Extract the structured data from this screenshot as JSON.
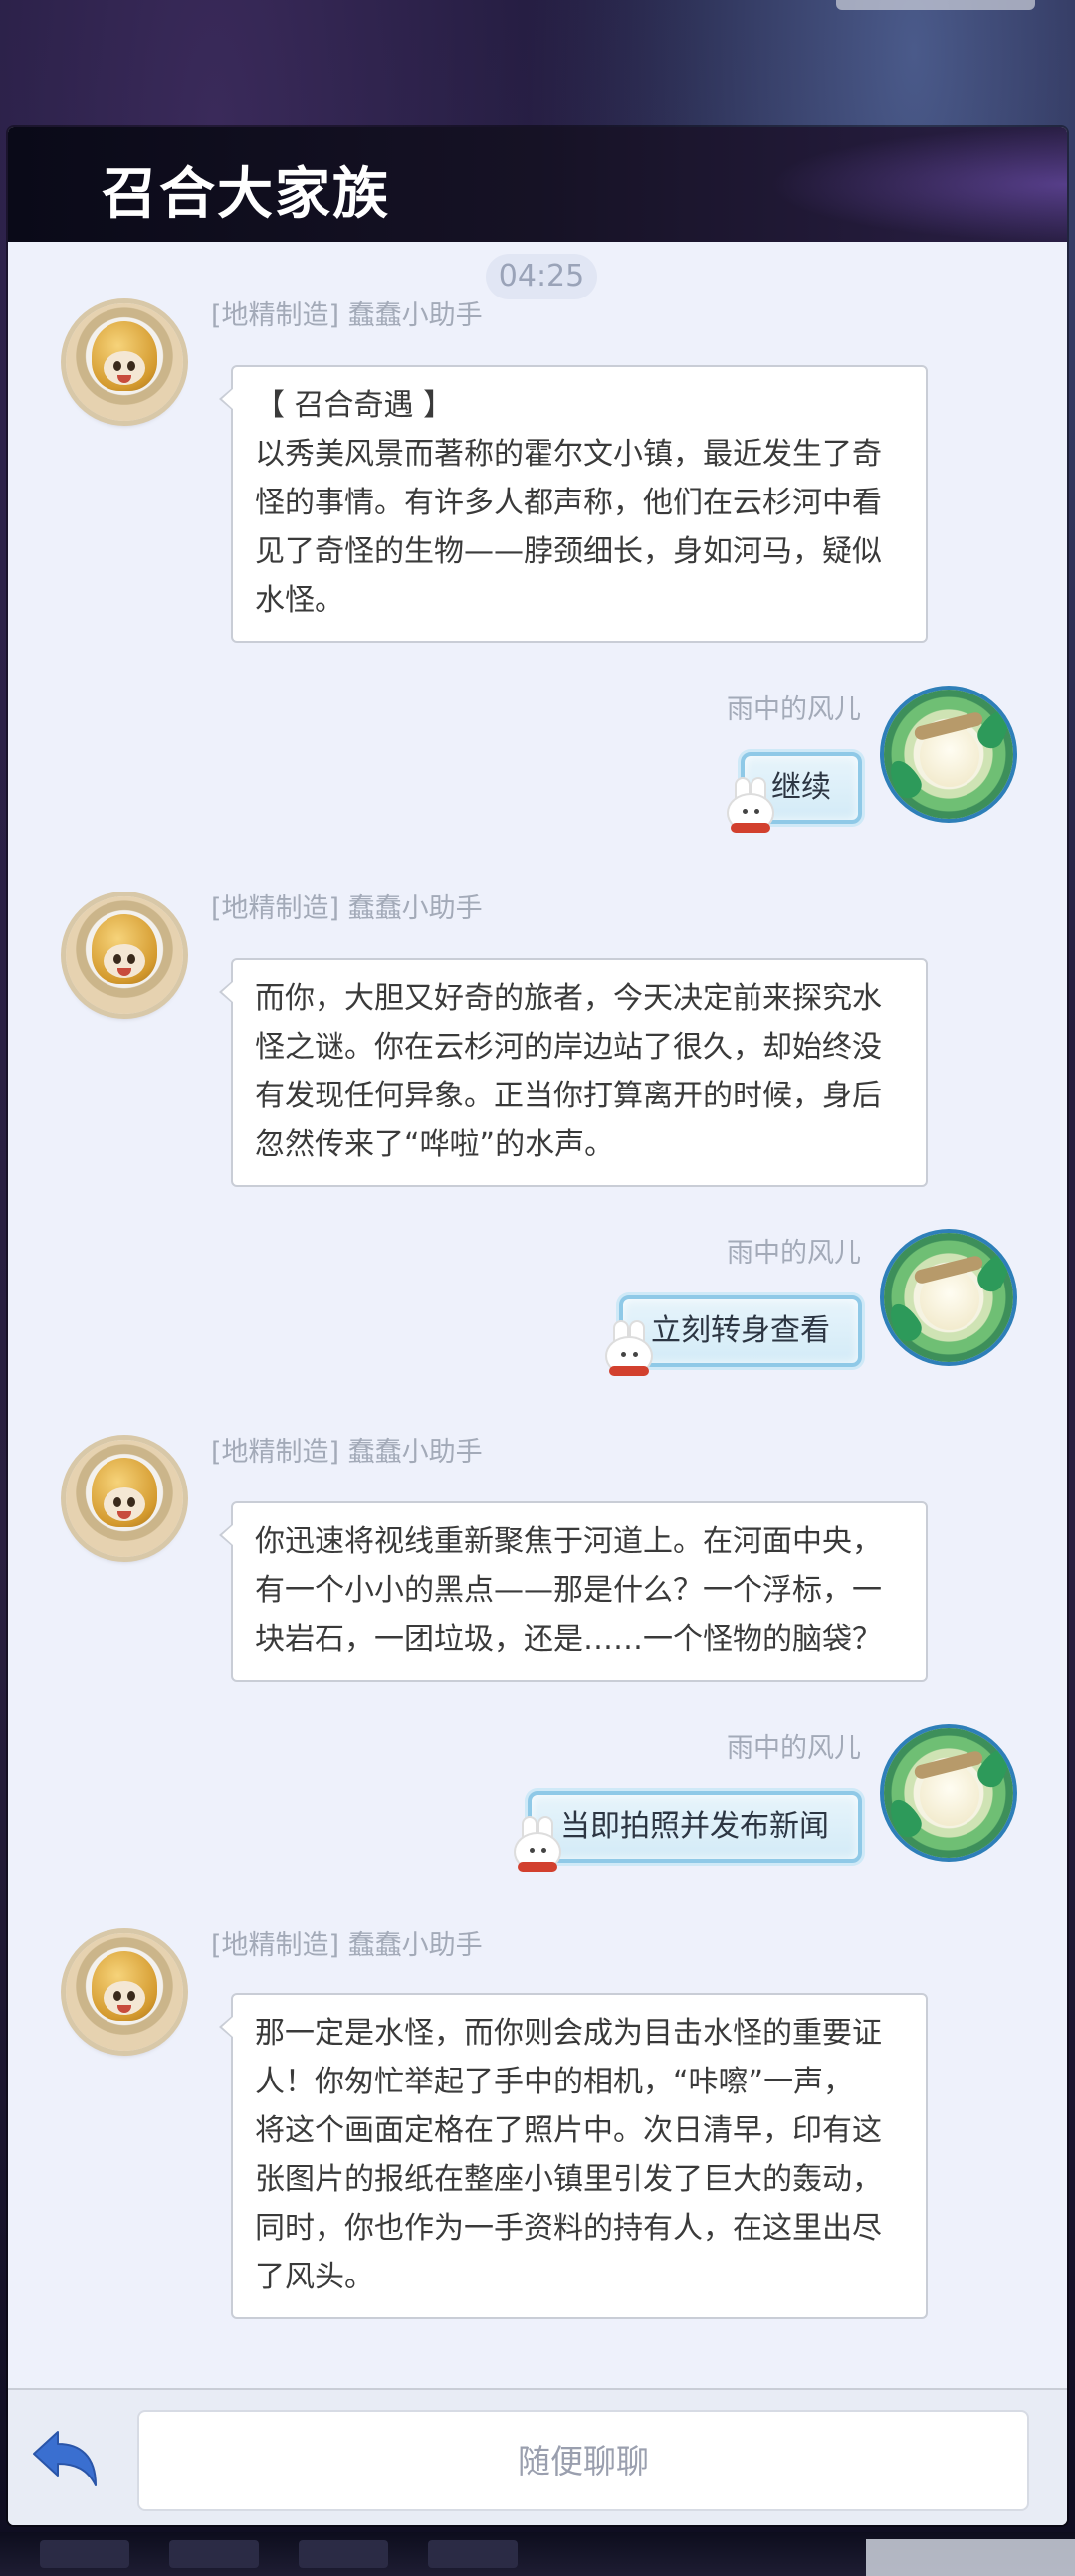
{
  "window": {
    "title": "召合大家族"
  },
  "timestamp": "04:25",
  "messages": [
    {
      "sender": "[地精制造] 蠢蠢小助手",
      "lines": [
        "【 召合奇遇 】",
        "以秀美风景而著称的霍尔文小镇，最近发生了奇",
        "怪的事情。有许多人都声称，他们在云杉河中看",
        "见了奇怪的生物——脖颈细长，身如河马，疑似",
        "水怪。"
      ]
    },
    {
      "sender": "雨中的风儿",
      "text": "继续"
    },
    {
      "sender": "[地精制造] 蠢蠢小助手",
      "lines": [
        "而你，大胆又好奇的旅者，今天决定前来探究水",
        "怪之谜。你在云杉河的岸边站了很久，却始终没",
        "有发现任何异象。正当你打算离开的时候，身后",
        "忽然传来了“哗啦”的水声。"
      ]
    },
    {
      "sender": "雨中的风儿",
      "text": "立刻转身查看"
    },
    {
      "sender": "[地精制造] 蠢蠢小助手",
      "lines": [
        "你迅速将视线重新聚焦于河道上。在河面中央，",
        "有一个小小的黑点——那是什么？一个浮标，一",
        "块岩石，一团垃圾，还是……一个怪物的脑袋？"
      ]
    },
    {
      "sender": "雨中的风儿",
      "text": "当即拍照并发布新闻"
    },
    {
      "sender": "[地精制造] 蠢蠢小助手",
      "lines": [
        "那一定是水怪，而你则会成为目击水怪的重要证",
        "人！你匆忙举起了手中的相机，“咔嚓”一声，",
        "将这个画面定格在了照片中。次日清早，印有这",
        "张图片的报纸在整座小镇里引发了巨大的轰动，",
        "同时，你也作为一手资料的持有人，在这里出尽",
        "了风头。"
      ]
    }
  ],
  "footer": {
    "input_placeholder": "随便聊聊"
  },
  "icons": {
    "back": "back-arrow-icon",
    "bot_avatar": "gnome-helper-avatar",
    "user_avatar": "player-avatar",
    "bunny": "bunny-mascot-icon"
  },
  "colors": {
    "bubble_user_border": "#8fc9e7",
    "bubble_bot_border": "#c9cdd6",
    "back_arrow": "#3a6fd0"
  }
}
